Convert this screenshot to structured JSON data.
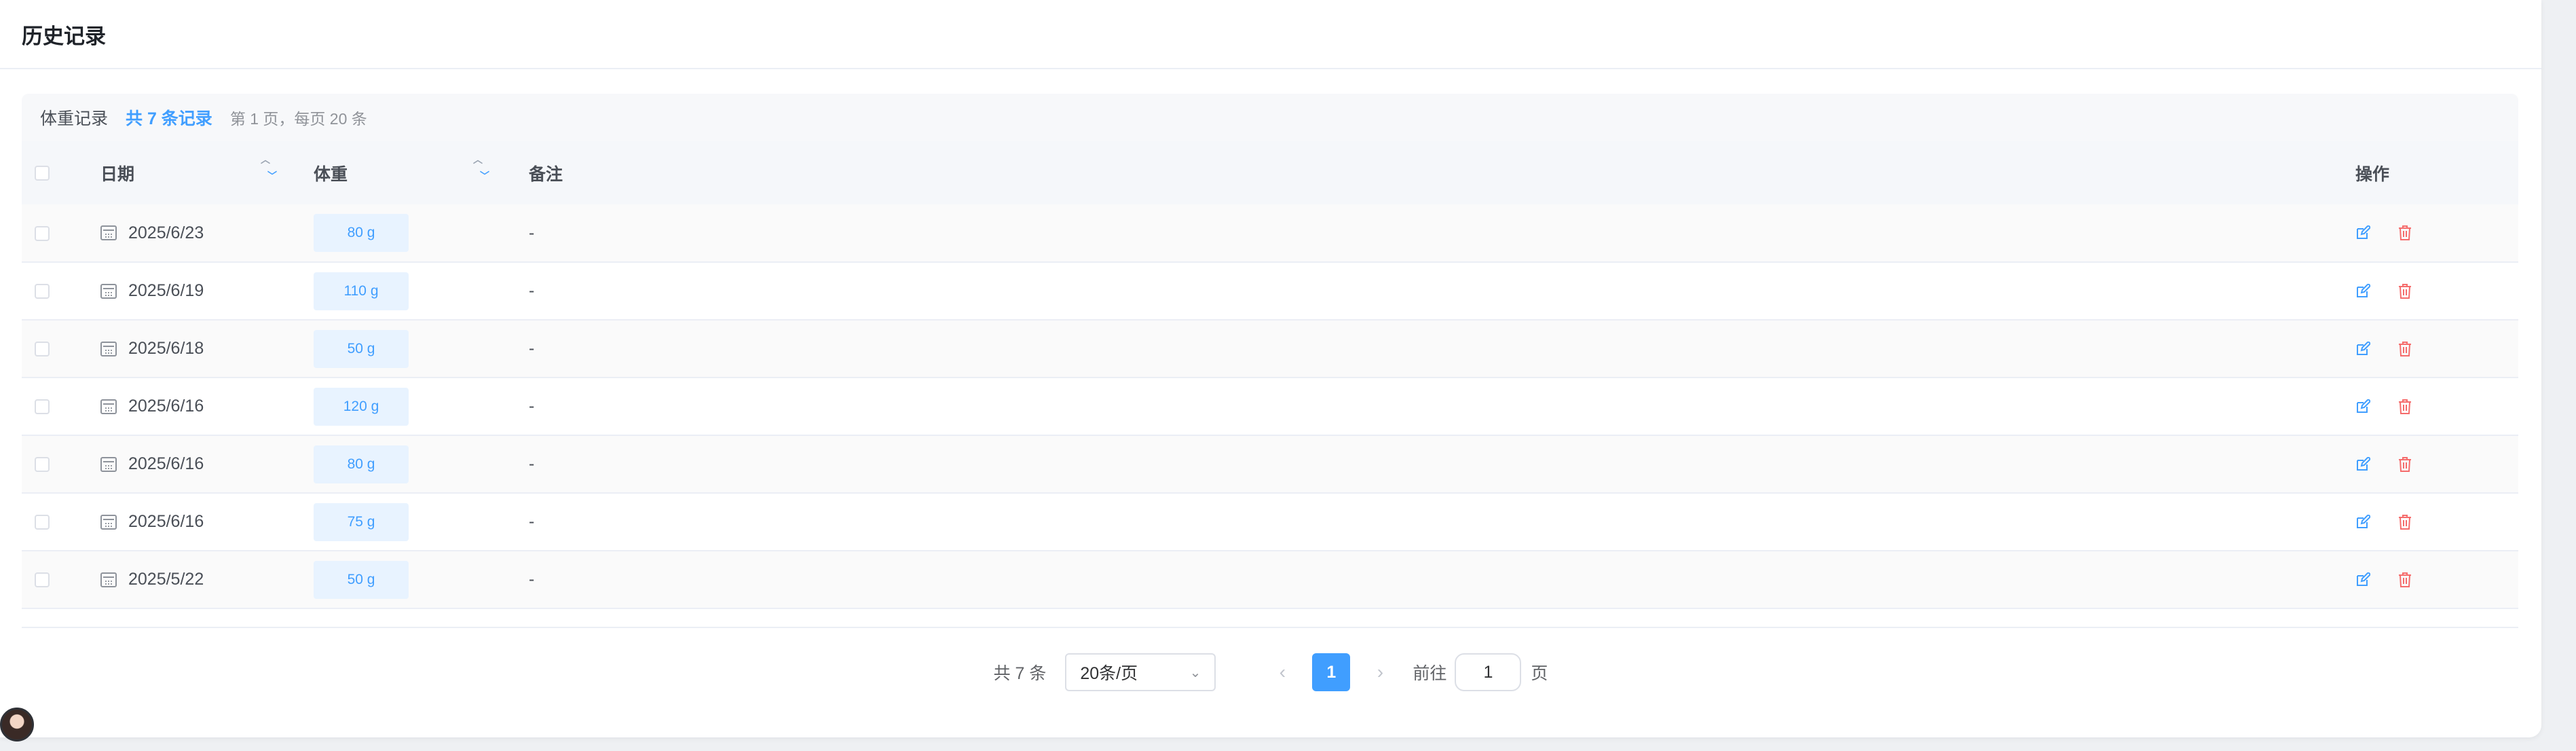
{
  "header": {
    "title": "历史记录"
  },
  "summary": {
    "title": "体重记录",
    "count": "共 7 条记录",
    "page_info": "第 1 页，每页 20 条"
  },
  "table": {
    "columns": [
      "日期",
      "体重",
      "备注",
      "操作"
    ],
    "rows": [
      {
        "date": "2025/6/23",
        "weight": "80 g",
        "note": "-"
      },
      {
        "date": "2025/6/19",
        "weight": "110 g",
        "note": "-"
      },
      {
        "date": "2025/6/18",
        "weight": "50 g",
        "note": "-"
      },
      {
        "date": "2025/6/16",
        "weight": "120 g",
        "note": "-"
      },
      {
        "date": "2025/6/16",
        "weight": "80 g",
        "note": "-"
      },
      {
        "date": "2025/6/16",
        "weight": "75 g",
        "note": "-"
      },
      {
        "date": "2025/5/22",
        "weight": "50 g",
        "note": "-"
      }
    ]
  },
  "pagination": {
    "total": "共 7 条",
    "page_size": "20条/页",
    "current_page": "1",
    "goto_label": "前往",
    "goto_value": "1",
    "goto_suffix": "页"
  },
  "colors": {
    "accent": "#409eff",
    "danger": "#f56c6c",
    "tag_bg": "#e8f3ff"
  }
}
